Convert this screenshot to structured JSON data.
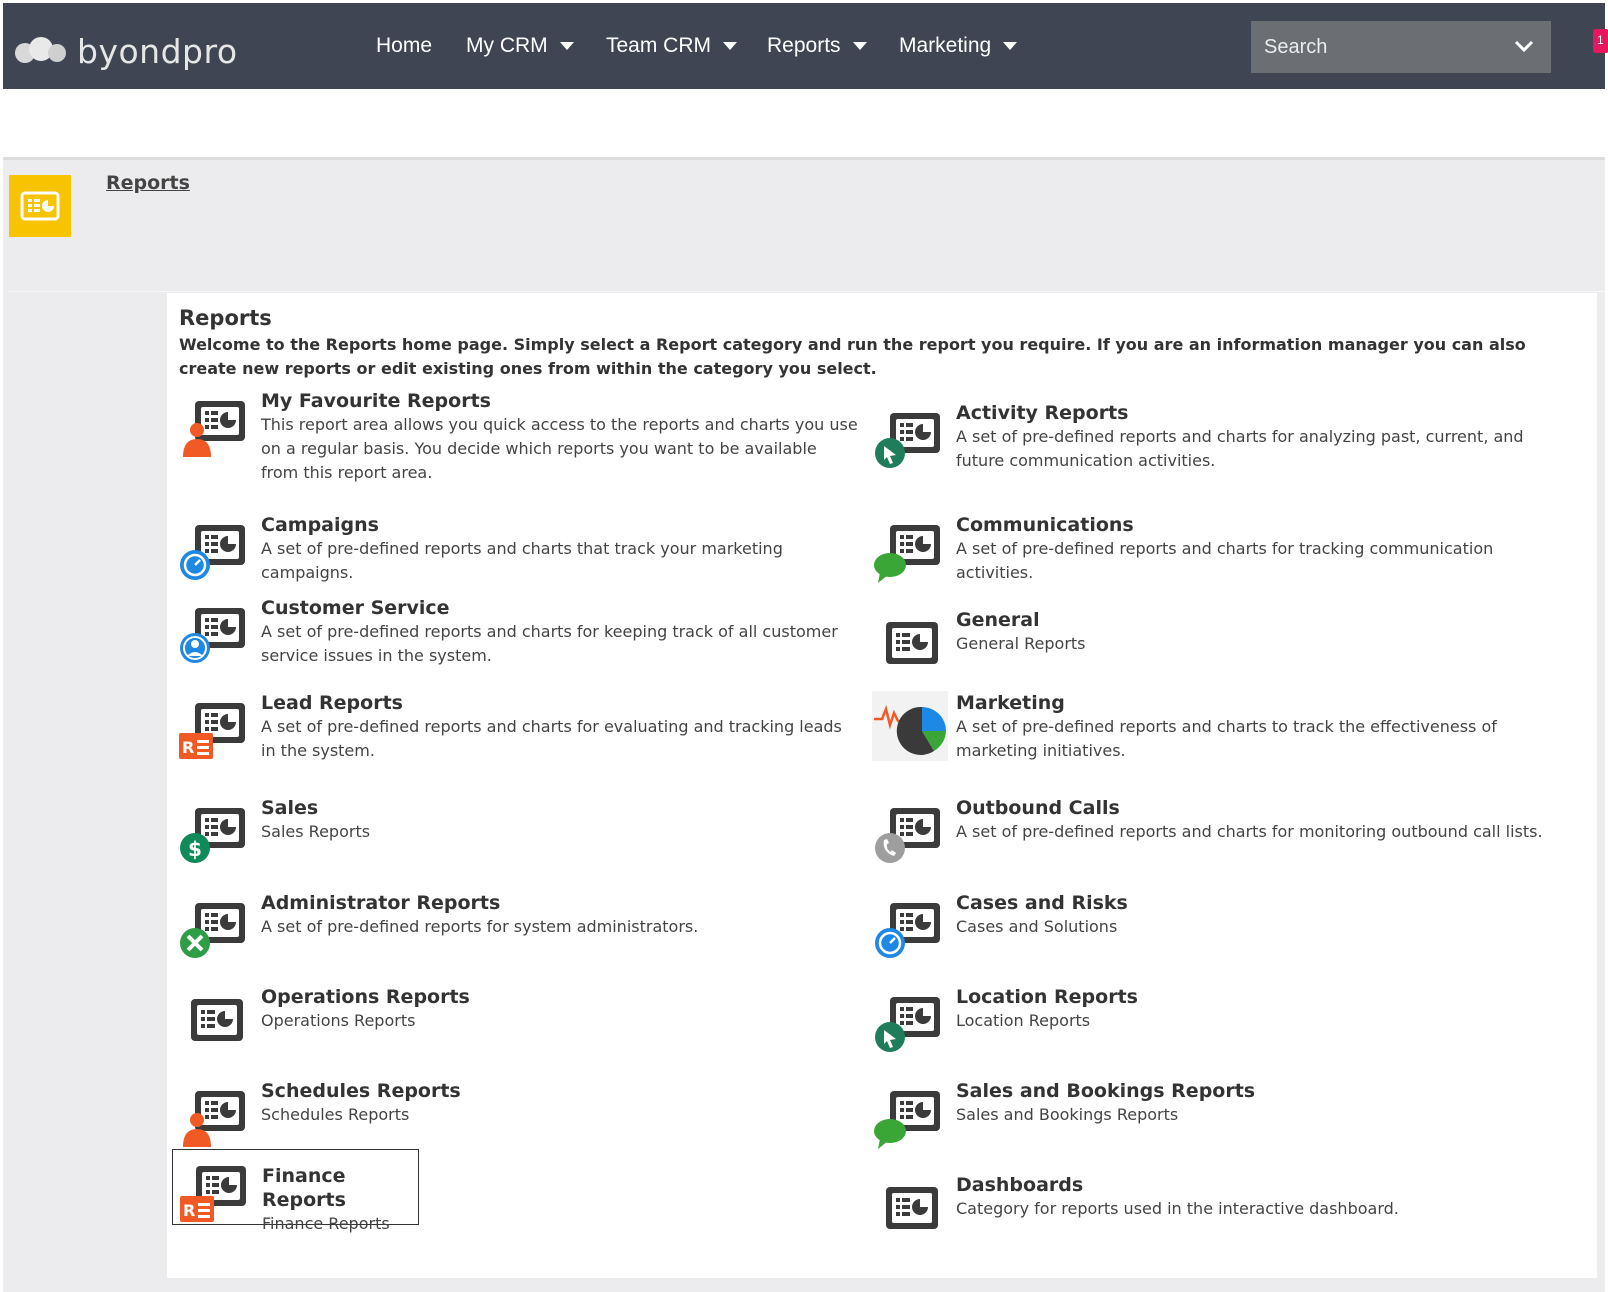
{
  "app": {
    "logo_text": "byondpro"
  },
  "nav": {
    "home": "Home",
    "my_crm": "My CRM",
    "team_crm": "Team CRM",
    "reports": "Reports",
    "marketing": "Marketing"
  },
  "search": {
    "placeholder": "Search"
  },
  "notification_count": "1",
  "breadcrumb": {
    "link": "Reports"
  },
  "main": {
    "title": "Reports",
    "intro": "Welcome to the Reports home page. Simply select a Report category and run the report you require. If you are an information manager you can also create new reports or edit existing ones from within the category you select."
  },
  "categories": [
    {
      "title": "My Favourite Reports",
      "description": "This report area allows you quick access to the reports and charts you use on a regular basis. You decide which reports you want to be available from this report area.",
      "icon": "person-report-icon"
    },
    {
      "title": "Activity Reports",
      "description": "A set of pre-defined reports and charts for analyzing past, current, and future communication activities.",
      "icon": "cursor-report-icon"
    },
    {
      "title": "Campaigns",
      "description": "A set of pre-defined reports and charts that track your marketing campaigns.",
      "icon": "stopwatch-report-icon"
    },
    {
      "title": "Communications",
      "description": "A set of pre-defined reports and charts for tracking communication activities.",
      "icon": "chat-report-icon"
    },
    {
      "title": "Customer Service",
      "description": "A set of pre-defined reports and charts for keeping track of all customer service issues in the system.",
      "icon": "user-circle-report-icon"
    },
    {
      "title": "General",
      "description": "General Reports",
      "icon": "report-icon"
    },
    {
      "title": "Lead Reports",
      "description": "A set of pre-defined reports and charts for evaluating and tracking leads in the system.",
      "icon": "lead-card-report-icon"
    },
    {
      "title": "Marketing",
      "description": "A set of pre-defined reports and charts to track the effectiveness of marketing initiatives.",
      "icon": "pie-chart-icon"
    },
    {
      "title": "Sales",
      "description": "Sales Reports",
      "icon": "dollar-report-icon"
    },
    {
      "title": "Outbound Calls",
      "description": "A set of pre-defined reports and charts for monitoring outbound call lists.",
      "icon": "phone-report-icon"
    },
    {
      "title": "Administrator Reports",
      "description": "A set of pre-defined reports for system administrators.",
      "icon": "tools-report-icon"
    },
    {
      "title": "Cases and Risks",
      "description": "Cases and Solutions",
      "icon": "stopwatch-report-icon"
    },
    {
      "title": "Operations Reports",
      "description": "Operations Reports",
      "icon": "report-icon"
    },
    {
      "title": "Location Reports",
      "description": "Location Reports",
      "icon": "cursor-report-icon"
    },
    {
      "title": "Schedules Reports",
      "description": "Schedules Reports",
      "icon": "person-report-icon"
    },
    {
      "title": "Sales and Bookings Reports",
      "description": "Sales and Bookings Reports",
      "icon": "chat-report-icon"
    },
    {
      "title": "Finance Reports",
      "description": "Finance Reports",
      "icon": "lead-card-report-icon"
    },
    {
      "title": "Dashboards",
      "description": "Category for reports used in the interactive dashboard.",
      "icon": "report-icon"
    }
  ],
  "colors": {
    "topbar": "#3f4552",
    "badge_yellow": "#f8c300",
    "orange": "#f15a24",
    "green": "#1e7e5c",
    "blue": "#1e88e5",
    "chat_green": "#3aa635",
    "dollar_green": "#118a5a",
    "gray": "#9e9e9e",
    "tools_green": "#2e9e46",
    "notification": "#e8175d"
  }
}
